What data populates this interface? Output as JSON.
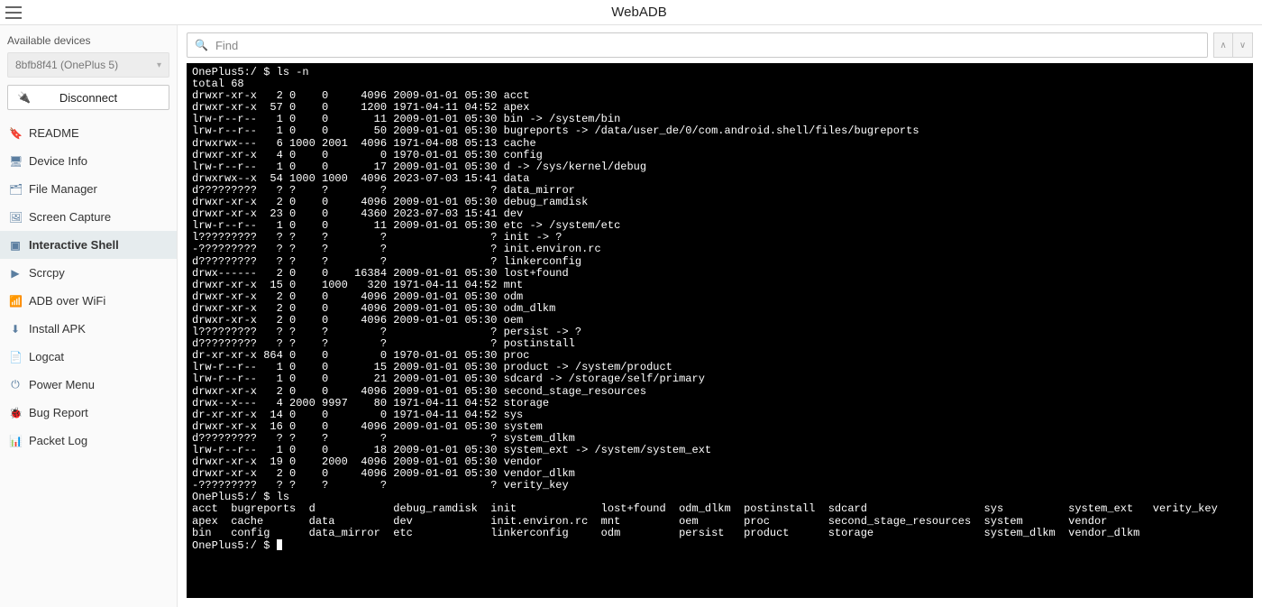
{
  "app": {
    "title": "WebADB"
  },
  "sidebar": {
    "sectionLabel": "Available devices",
    "device": "8bfb8f41 (OnePlus 5)",
    "disconnectLabel": "Disconnect",
    "items": [
      {
        "icon": "🔖",
        "label": "README"
      },
      {
        "icon": "🖥",
        "label": "Device Info"
      },
      {
        "icon": "🗂",
        "label": "File Manager"
      },
      {
        "icon": "🖼",
        "label": "Screen Capture"
      },
      {
        "icon": "▣",
        "label": "Interactive Shell"
      },
      {
        "icon": "▶",
        "label": "Scrcpy"
      },
      {
        "icon": "📶",
        "label": "ADB over WiFi"
      },
      {
        "icon": "⬇",
        "label": "Install APK"
      },
      {
        "icon": "📄",
        "label": "Logcat"
      },
      {
        "icon": "⏻",
        "label": "Power Menu"
      },
      {
        "icon": "🐞",
        "label": "Bug Report"
      },
      {
        "icon": "📊",
        "label": "Packet Log"
      }
    ],
    "activeIndex": 4
  },
  "find": {
    "placeholder": "Find"
  },
  "terminal": {
    "lines": [
      "OnePlus5:/ $ ls -n",
      "total 68",
      "drwxr-xr-x   2 0    0     4096 2009-01-01 05:30 acct",
      "drwxr-xr-x  57 0    0     1200 1971-04-11 04:52 apex",
      "lrw-r--r--   1 0    0       11 2009-01-01 05:30 bin -> /system/bin",
      "lrw-r--r--   1 0    0       50 2009-01-01 05:30 bugreports -> /data/user_de/0/com.android.shell/files/bugreports",
      "drwxrwx---   6 1000 2001  4096 1971-04-08 05:13 cache",
      "drwxr-xr-x   4 0    0        0 1970-01-01 05:30 config",
      "lrw-r--r--   1 0    0       17 2009-01-01 05:30 d -> /sys/kernel/debug",
      "drwxrwx--x  54 1000 1000  4096 2023-07-03 15:41 data",
      "d?????????   ? ?    ?        ?                ? data_mirror",
      "drwxr-xr-x   2 0    0     4096 2009-01-01 05:30 debug_ramdisk",
      "drwxr-xr-x  23 0    0     4360 2023-07-03 15:41 dev",
      "lrw-r--r--   1 0    0       11 2009-01-01 05:30 etc -> /system/etc",
      "l?????????   ? ?    ?        ?                ? init -> ?",
      "-?????????   ? ?    ?        ?                ? init.environ.rc",
      "d?????????   ? ?    ?        ?                ? linkerconfig",
      "drwx------   2 0    0    16384 2009-01-01 05:30 lost+found",
      "drwxr-xr-x  15 0    1000   320 1971-04-11 04:52 mnt",
      "drwxr-xr-x   2 0    0     4096 2009-01-01 05:30 odm",
      "drwxr-xr-x   2 0    0     4096 2009-01-01 05:30 odm_dlkm",
      "drwxr-xr-x   2 0    0     4096 2009-01-01 05:30 oem",
      "l?????????   ? ?    ?        ?                ? persist -> ?",
      "d?????????   ? ?    ?        ?                ? postinstall",
      "dr-xr-xr-x 864 0    0        0 1970-01-01 05:30 proc",
      "lrw-r--r--   1 0    0       15 2009-01-01 05:30 product -> /system/product",
      "lrw-r--r--   1 0    0       21 2009-01-01 05:30 sdcard -> /storage/self/primary",
      "drwxr-xr-x   2 0    0     4096 2009-01-01 05:30 second_stage_resources",
      "drwx--x---   4 2000 9997    80 1971-04-11 04:52 storage",
      "dr-xr-xr-x  14 0    0        0 1971-04-11 04:52 sys",
      "drwxr-xr-x  16 0    0     4096 2009-01-01 05:30 system",
      "d?????????   ? ?    ?        ?                ? system_dlkm",
      "lrw-r--r--   1 0    0       18 2009-01-01 05:30 system_ext -> /system/system_ext",
      "drwxr-xr-x  19 0    2000  4096 2009-01-01 05:30 vendor",
      "drwxr-xr-x   2 0    0     4096 2009-01-01 05:30 vendor_dlkm",
      "-?????????   ? ?    ?        ?                ? verity_key",
      "OnePlus5:/ $ ls",
      "acct  bugreports  d            debug_ramdisk  init             lost+found  odm_dlkm  postinstall  sdcard                  sys          system_ext   verity_key",
      "apex  cache       data         dev            init.environ.rc  mnt         oem       proc         second_stage_resources  system       vendor",
      "bin   config      data_mirror  etc            linkerconfig     odm         persist   product      storage                 system_dlkm  vendor_dlkm",
      "OnePlus5:/ $ "
    ]
  }
}
